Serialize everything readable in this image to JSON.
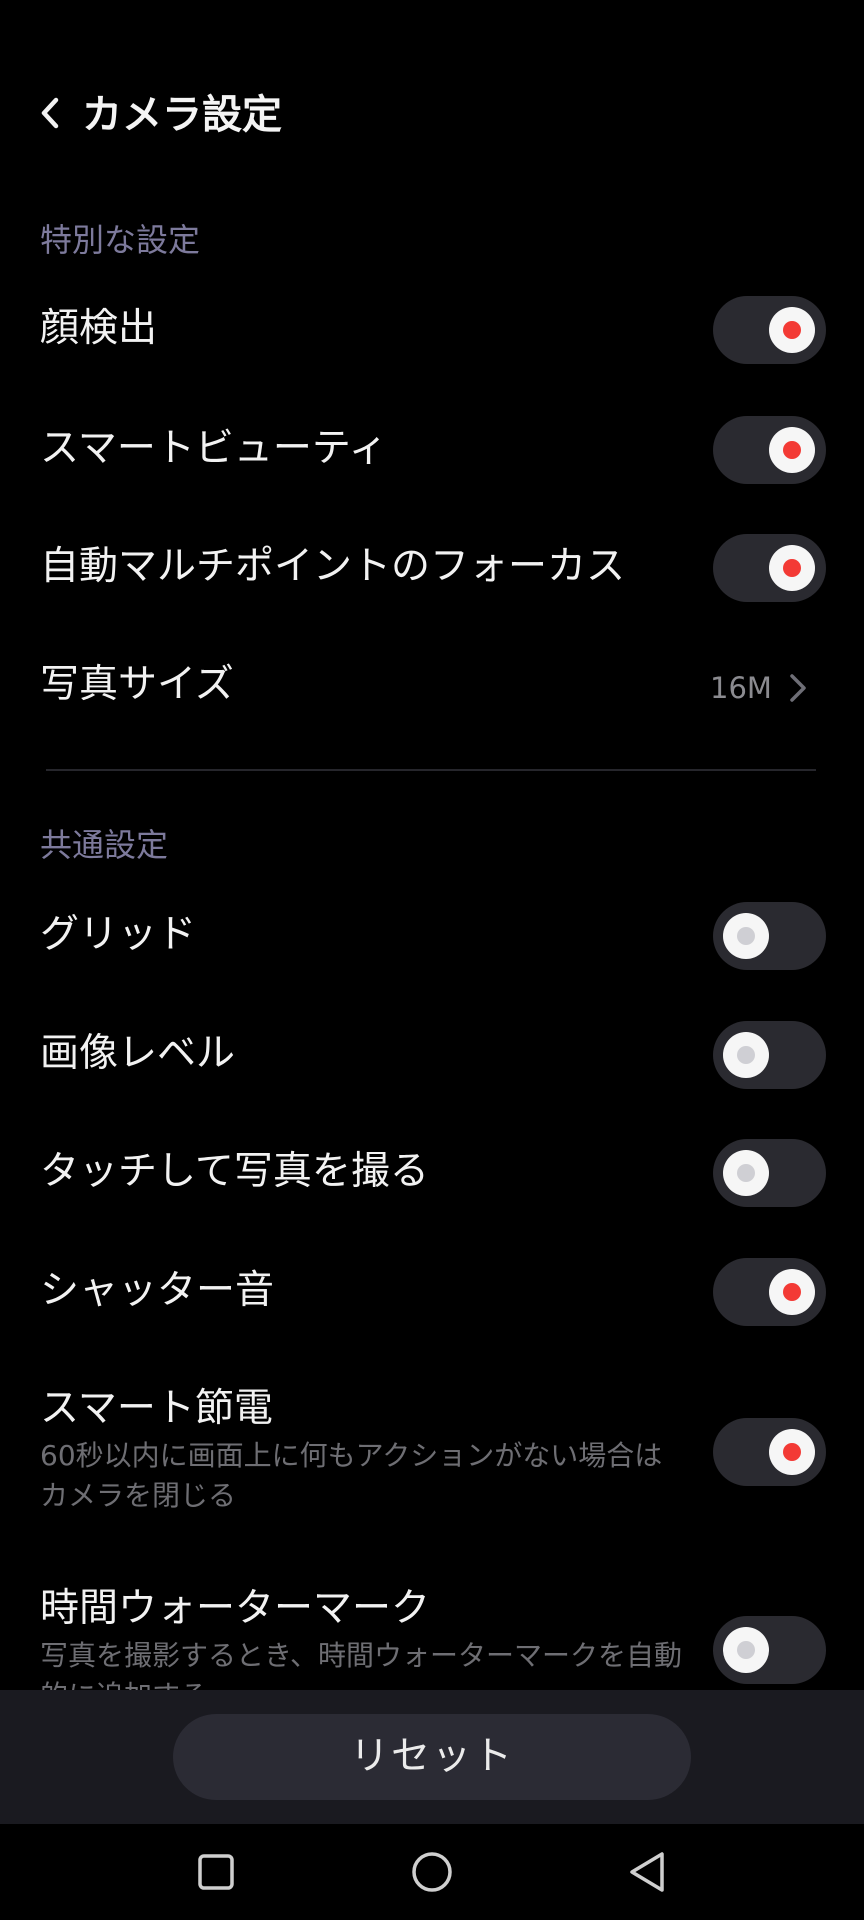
{
  "header": {
    "title": "カメラ設定",
    "back_icon": "chevron-left-icon"
  },
  "sections": {
    "special": "特別な設定",
    "common": "共通設定"
  },
  "settings": {
    "face_detection": {
      "label": "顔検出",
      "on": true
    },
    "smart_beauty": {
      "label": "スマートビューティ",
      "on": true
    },
    "auto_multipoint_focus": {
      "label": "自動マルチポイントのフォーカス",
      "on": true
    },
    "photo_size": {
      "label": "写真サイズ",
      "value": "16M"
    },
    "grid": {
      "label": "グリッド",
      "on": false
    },
    "image_level": {
      "label": "画像レベル",
      "on": false
    },
    "touch_capture": {
      "label": "タッチして写真を撮る",
      "on": false
    },
    "shutter_sound": {
      "label": "シャッター音",
      "on": true
    },
    "smart_power_saving": {
      "label": "スマート節電",
      "description": "60秒以内に画面上に何もアクションがない場合はカメラを閉じる",
      "on": true
    },
    "time_watermark": {
      "label": "時間ウォーターマーク",
      "description": "写真を撮影するとき、時間ウォーターマークを自動的に追加する",
      "on": false
    }
  },
  "footer": {
    "reset_label": "リセット"
  },
  "nav": {
    "recents_icon": "square-icon",
    "home_icon": "circle-icon",
    "back_icon": "triangle-back-icon"
  },
  "colors": {
    "background": "#000000",
    "section_title": "#7d7a9c",
    "toggle_track": "#2a2a30",
    "toggle_on_dot": "#f33a35",
    "toggle_off_dot": "#cfcfd4",
    "bottom_bar": "#1a1a20",
    "reset_button": "#2b2b34"
  }
}
